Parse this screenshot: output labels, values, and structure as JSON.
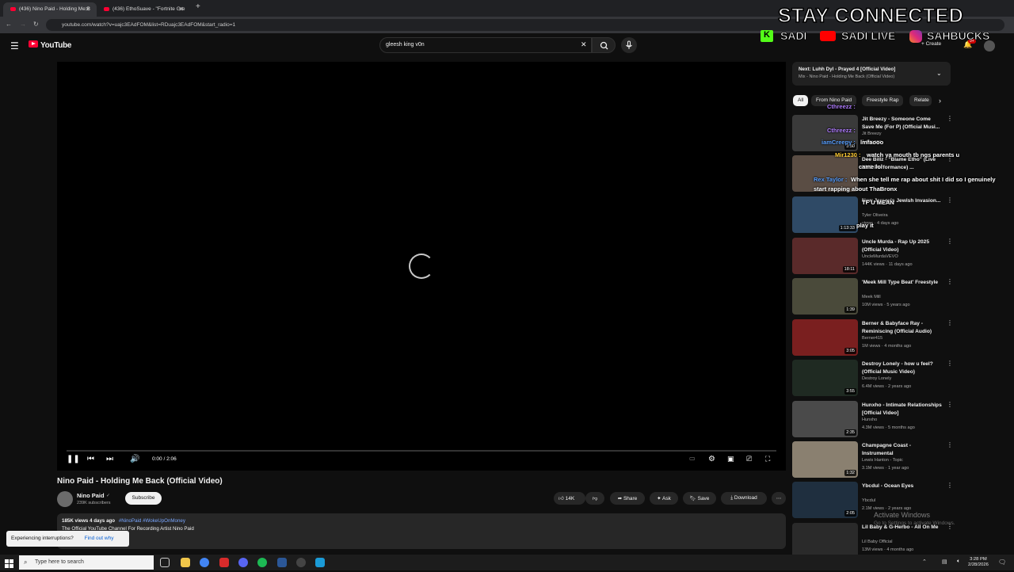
{
  "browser": {
    "tabs": [
      {
        "title": "(436) Nino Paid - Holding Me B",
        "active": true
      },
      {
        "title": "(436) EthoSuave - \"Fortnite Gre",
        "active": false
      }
    ],
    "url": "youtube.com/watch?v=uajc3EAdFOM&list=RDuajc3EAdFOM&start_radio=1"
  },
  "yt": {
    "logo": "YouTube",
    "search_value": "gleesh king v0n",
    "create_label": "Create",
    "notif_count": "9+"
  },
  "player": {
    "time": "0:00 / 2:06"
  },
  "video": {
    "title": "Nino Paid - Holding Me Back (Official Video)",
    "channel": "Nino Paid",
    "subscribers": "239K subscribers",
    "subscribe": "Subscribe",
    "likes": "14K",
    "share": "Share",
    "ask": "Ask",
    "save": "Save",
    "download": "Download",
    "views_date": "185K views  4 days ago",
    "hashtags": "#NinoPaid #WokeUpOnMoney",
    "desc_line": "The Official YouTube Channel For Recording Artist Nino Paid"
  },
  "toast": {
    "text": "Experiencing interruptions?",
    "link": "Find out why"
  },
  "sidebar": {
    "next_label": "Next: Luhh Dyl - Prayed 4 [Official Video]",
    "next_sub": "Mix - Nino Paid - Holding Me Back (Official Video)",
    "chips": [
      "All",
      "From Nino Paid",
      "Freestyle Rap",
      "Relate"
    ],
    "recs": [
      {
        "title": "Jit Breezy - Someone Come Save Me (For P) (Official Musi...",
        "channel": "Jit Breezy",
        "meta": "1 day ago",
        "dur": "3:50"
      },
      {
        "title": "Dee Billz - \"Blame Etho\" (Live NYC Performance) ...",
        "channel": "",
        "meta": "",
        "dur": ""
      },
      {
        "title": "New Jersey's Jewish Invasion...",
        "channel": "Tyler Oliveira",
        "meta": "views · 4 days ago",
        "dur": "1:13:33"
      },
      {
        "title": "Uncle Murda - Rap Up 2025 (Official Video)",
        "channel": "UncleMurdaVEVO",
        "meta": "144K views · 11 days ago",
        "dur": "18:11"
      },
      {
        "title": "'Meek Mill Type Beat' Freestyle",
        "channel": "Meek Mill",
        "meta": "10M views · 5 years ago",
        "dur": "1:39"
      },
      {
        "title": "Berner & Babyface Ray - Reminiscing (Official Audio)",
        "channel": "Berner415",
        "meta": "1M views · 4 months ago",
        "dur": "3:05"
      },
      {
        "title": "Destroy Lonely - how u feel? (Official Music Video)",
        "channel": "Destroy Lonely",
        "meta": "6.4M views · 2 years ago",
        "dur": "3:55"
      },
      {
        "title": "Hunxho - Intimate Relationships [Official Video]",
        "channel": "Hunxho",
        "meta": "4.3M views · 5 months ago",
        "dur": "2:35"
      },
      {
        "title": "Champagne Coast - Instrumental",
        "channel": "Lewis Hanton - Topic",
        "meta": "3.1M views · 1 year ago",
        "dur": "1:32"
      },
      {
        "title": "Ybcdul - Ocean Eyes",
        "channel": "Ybcdul",
        "meta": "2.1M views · 2 years ago",
        "dur": "2:05"
      },
      {
        "title": "Lil Baby & G-Herbo - All On Me",
        "channel": "Lil Baby Official",
        "meta": "13M views · 4 months ago",
        "dur": ""
      }
    ]
  },
  "overlay": {
    "title": "STAY CONNECTED",
    "kick": "SADI",
    "youtube": "SADI LIVE",
    "instagram": "SAHBUCKS",
    "chat": [
      {
        "user": "Cthreezz :",
        "msg": ""
      },
      {
        "user": "Cthreezz :",
        "msg": ""
      },
      {
        "user": "iamCreepy :",
        "msg": "lmfaooo"
      },
      {
        "user": "Mir1230 :",
        "msg": "watch ya mouth tb ngs parents u"
      },
      {
        "user": "",
        "msg": "came lol"
      },
      {
        "user": "Rex Taylor :",
        "msg": "When she tell me rap about shit I did so I genuinely"
      },
      {
        "user": "",
        "msg": "start rapping about ThaBronx"
      },
      {
        "user": "",
        "msg": "TF U MEAN"
      },
      {
        "user": "",
        "msg": "play it"
      }
    ]
  },
  "windows": {
    "activate": "Activate Windows",
    "activate_sub": "Go to Settings to activate Windows.",
    "search_placeholder": "Type here to search",
    "time": "3:28 PM",
    "date": "2/28/2026"
  },
  "colors": {
    "yt_red": "#ff0033",
    "bg": "#0f0f0f",
    "chip_active": "#f1f1f1"
  }
}
